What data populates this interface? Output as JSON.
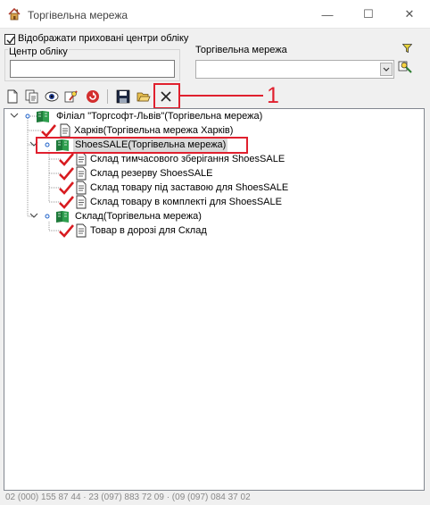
{
  "window": {
    "title": "Торгівельна мережа",
    "minimize_glyph": "—",
    "maximize_glyph": "☐",
    "close_glyph": "✕"
  },
  "filters": {
    "show_hidden_label": "Відображати приховані центри обліку",
    "show_hidden_checked": true,
    "center_label": "Центр обліку",
    "center_value": "",
    "network_label": "Торгівельна мережа",
    "network_value": ""
  },
  "toolbar": {
    "icons": [
      "new-icon",
      "copy-icon",
      "view-icon",
      "edit-icon",
      "refresh-icon",
      "save-icon",
      "open-icon",
      "delete-icon"
    ]
  },
  "annotation": {
    "callout_number": "1",
    "color": "#e0202e"
  },
  "tree": {
    "nodes": [
      {
        "label": "Філіал \"Торгсофт-Львів\"(Торгівельна мережа)",
        "type": "folder",
        "level": 0,
        "expanded": true
      },
      {
        "label": "Харків(Торгівельна мережа Харків)",
        "type": "doc",
        "level": 1
      },
      {
        "label": "ShoesSALE(Торгівельна мережа)",
        "type": "folder",
        "level": 1,
        "expanded": true,
        "selected": true
      },
      {
        "label": "Склад тимчасового зберігання ShoesSALE",
        "type": "doc",
        "level": 2
      },
      {
        "label": "Склад резерву ShoesSALE",
        "type": "doc",
        "level": 2
      },
      {
        "label": "Склад товару під заставою для ShoesSALE",
        "type": "doc",
        "level": 2
      },
      {
        "label": "Склад товару в комплекті для ShoesSALE",
        "type": "doc",
        "level": 2
      },
      {
        "label": "Склад(Торгівельна мережа)",
        "type": "folder",
        "level": 1,
        "expanded": true
      },
      {
        "label": "Товар в дорозі для Склад",
        "type": "doc",
        "level": 2
      }
    ]
  },
  "status_text": "02 (000) 155 87 44 · 23 (097) 883 72 09 · (09 (097) 084 37 02"
}
